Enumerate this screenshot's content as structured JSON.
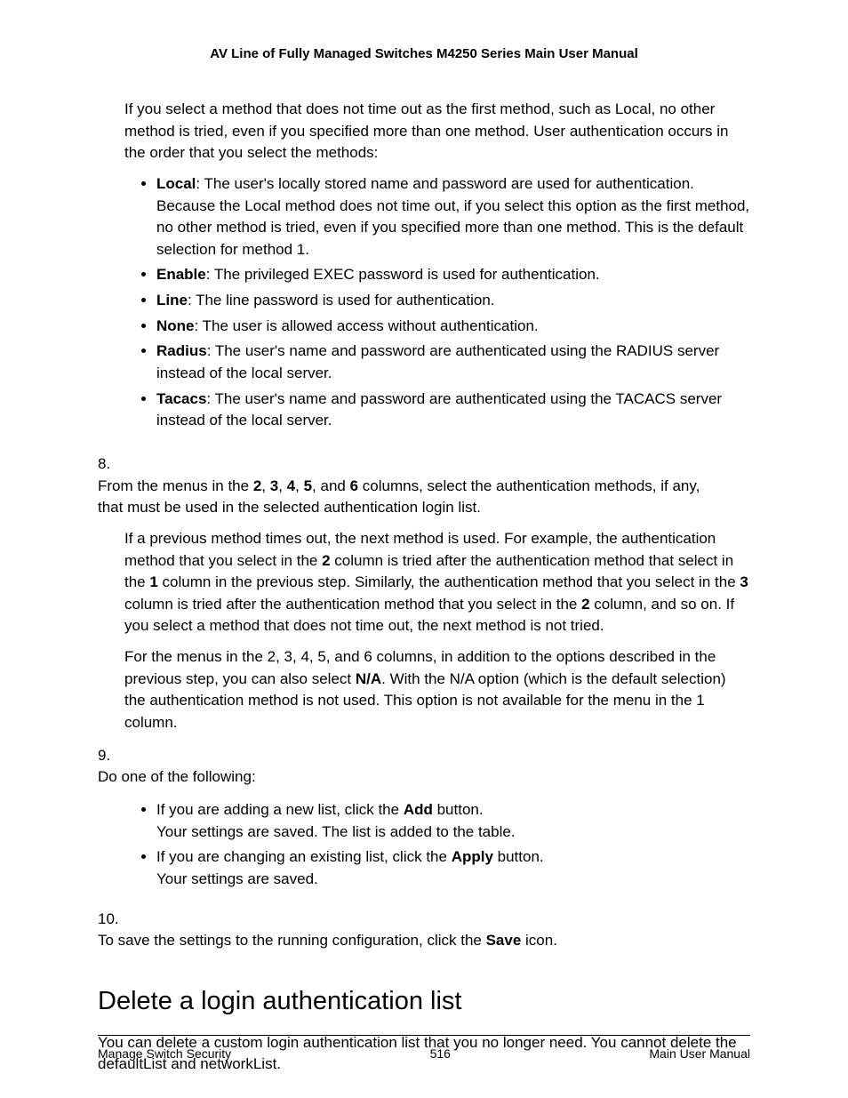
{
  "header": "AV Line of Fully Managed Switches M4250 Series Main User Manual",
  "intro": "If you select a method that does not time out as the first method, such as Local, no other method is tried, even if you specified more than one method. User authentication occurs in the order that you select the methods:",
  "auth": {
    "local": {
      "label": "Local",
      "text": ": The user's locally stored name and password are used for authentication. Because the Local method does not time out, if you select this option as the first method, no other method is tried, even if you specified more than one method. This is the default selection for method 1."
    },
    "enable": {
      "label": "Enable",
      "text": ": The privileged EXEC password is used for authentication."
    },
    "line": {
      "label": "Line",
      "text": ": The line password is used for authentication."
    },
    "none": {
      "label": "None",
      "text": ": The user is allowed access without authentication."
    },
    "radius": {
      "label": "Radius",
      "text": ": The user's name and password are authenticated using the RADIUS server instead of the local server."
    },
    "tacacs": {
      "label": "Tacacs",
      "text": ": The user's name and password are authenticated using the TACACS server instead of the local server."
    }
  },
  "step8": {
    "num": "8.",
    "p1_a": "From the menus in the ",
    "c2": "2",
    "c3": "3",
    "c4": "4",
    "c5": "5",
    "c6": "6",
    "sep": ", ",
    "and": ", and ",
    "p1_b": " columns, select the authentication methods, if any, that must be used in the selected authentication login list.",
    "p2_a": "If a previous method times out, the next method is used. For example, the authentication method that you select in the ",
    "p2_b": " column is tried after the authentication method that select in the ",
    "c1": "1",
    "p2_c": " column in the previous step. Similarly, the authentication method that you select in the ",
    "p2_d": " column is tried after the authentication method that you select in the ",
    "p2_e": " column, and so on. If you select a method that does not time out, the next method is not tried.",
    "p3_a": "For the menus in the 2, 3, 4, 5, and 6 columns, in addition to the options described in the previous step, you can also select ",
    "na": "N/A",
    "p3_b": ". With the N/A option (which is the default selection) the authentication method is not used. This option is not available for the menu in the 1 column."
  },
  "step9": {
    "num": "9.",
    "lead": "Do one of the following:",
    "add_a": "If you are adding a new list, click the ",
    "add_label": "Add",
    "add_b": " button.",
    "add_sub": "Your settings are saved. The list is added to the table.",
    "apply_a": "If you are changing an existing list, click the ",
    "apply_label": "Apply",
    "apply_b": " button.",
    "apply_sub": "Your settings are saved."
  },
  "step10": {
    "num": "10.",
    "a": "To save the settings to the running configuration, click the ",
    "save": "Save",
    "b": " icon."
  },
  "section": {
    "title": "Delete a login authentication list",
    "intro": "You can delete a custom login authentication list that you no longer need. You cannot delete the defaultList and networkList."
  },
  "footer": {
    "left": "Manage Switch Security",
    "center": "516",
    "right": "Main User Manual"
  }
}
